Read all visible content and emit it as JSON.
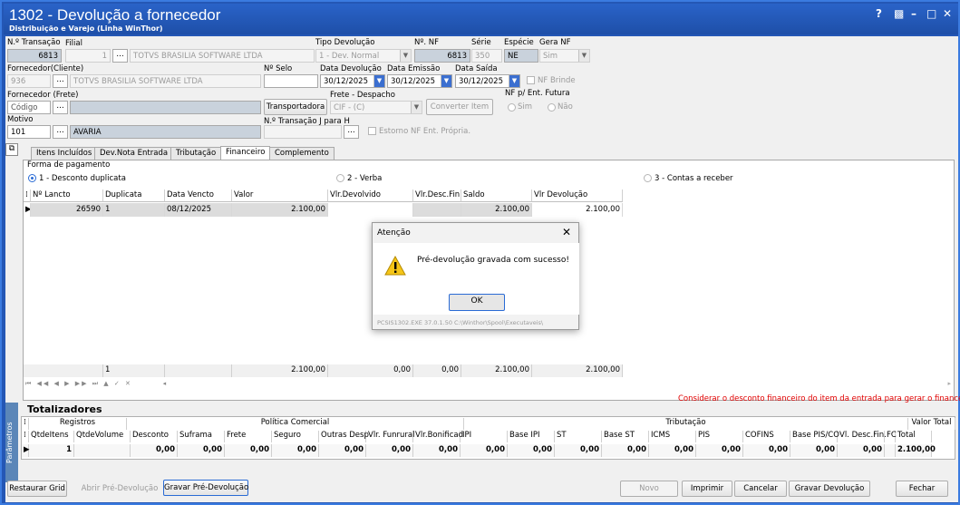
{
  "window": {
    "title": "1302 - Devolução a fornecedor",
    "subtitle": "Distribuição e Varejo (Linha WinThor)",
    "controls": {
      "help": "?",
      "restore": "▩",
      "minimize": "–",
      "maximize": "□",
      "close": "✕"
    }
  },
  "header": {
    "transacao_label": "N.º Transação",
    "transacao_value": "6813",
    "filial_label": "Filial",
    "filial_code": "1",
    "filial_name": "TOTVS BRASILIA SOFTWARE LTDA",
    "tipo_devolucao_label": "Tipo Devolução",
    "tipo_devolucao_value": "1 - Dev. Normal",
    "nf_label": "Nº. NF",
    "nf_value": "6813",
    "serie_label": "Série",
    "serie_value": "350",
    "especie_label": "Espécie",
    "especie_value": "NE",
    "gera_nf_label": "Gera NF",
    "gera_nf_value": "Sim",
    "fornecedor_cliente_label": "Fornecedor(Cliente)",
    "fornecedor_code": "936",
    "fornecedor_name": "TOTVS BRASILIA SOFTWARE LTDA",
    "selo_label": "Nº Selo",
    "selo_value": "",
    "data_devolucao_label": "Data Devolução",
    "data_devolucao_value": "30/12/2025",
    "data_emissao_label": "Data Emissão",
    "data_emissao_value": "30/12/2025",
    "data_saida_label": "Data Saída",
    "data_saida_value": "30/12/2025",
    "nf_brinde_label": "NF Brinde",
    "fornecedor_frete_label": "Fornecedor (Frete)",
    "fornecedor_frete_code": "Código",
    "transportadora_button": "Transportadora",
    "frete_label": "Frete - Despacho",
    "frete_value": "CIF - (C)",
    "converter_item_button": "Converter Item",
    "nf_futura_label": "NF p/ Ent. Futura",
    "nf_futura_sim": "Sim",
    "nf_futura_nao": "Não",
    "motivo_label": "Motivo",
    "motivo_code": "101",
    "motivo_name": "AVARIA",
    "transacao_j_label": "N.º Transação J para H",
    "estorno_label": "Estorno NF Ent. Própria.",
    "dots": "..."
  },
  "tabs": [
    {
      "label": "Itens Incluídos"
    },
    {
      "label": "Dev.Nota Entrada"
    },
    {
      "label": "Tributação"
    },
    {
      "label": "Financeiro"
    },
    {
      "label": "Complemento"
    }
  ],
  "financeiro": {
    "forma_pagamento_label": "Forma de pagamento",
    "opt1": "1 - Desconto duplicata",
    "opt2": "2 - Verba",
    "opt3": "3 - Contas a receber",
    "columns": [
      "Nº Lancto",
      "Duplicata",
      "Data Vencto",
      "Valor",
      "Vlr.Devolvido",
      "Vlr.Desc.Fin.",
      "Saldo",
      "Vlr Devolução"
    ],
    "row": {
      "lancto": "26590",
      "duplicata": "1",
      "vencto": "08/12/2025",
      "valor": "2.100,00",
      "devolvido": "",
      "desc": "",
      "saldo": "2.100,00",
      "devolucao": "2.100,00"
    },
    "footer": {
      "duplicata": "1",
      "valor": "2.100,00",
      "devolvido": "0,00",
      "desc": "0,00",
      "saldo": "2.100,00",
      "devolucao": "2.100,00"
    }
  },
  "totalizadores": {
    "title": "Totalizadores",
    "side_label": "Parâmetros",
    "warning": "Considerar o desconto financeiro do item da entrada para gerar o financeiro.",
    "groups": {
      "registros": "Registros",
      "politica": "Política Comercial",
      "tributacao": "Tributação",
      "valor_total": "Valor Total"
    },
    "columns": [
      "QtdeItens",
      "QtdeVolume",
      "Desconto",
      "Suframa",
      "Frete",
      "Seguro",
      "Outras Desp",
      "Vlr. Funrural",
      "Vlr.Bonificad",
      "IPI",
      "Base IPI",
      "ST",
      "Base ST",
      "ICMS",
      "PIS",
      "COFINS",
      "Base PIS/CO",
      "Vl. Desc.Fin.",
      "FC",
      "Total"
    ],
    "values": [
      "1",
      "",
      "0,00",
      "0,00",
      "0,00",
      "0,00",
      "0,00",
      "0,00",
      "0,00",
      "0,00",
      "0,00",
      "0,00",
      "0,00",
      "0,00",
      "0,00",
      "0,00",
      "0,00",
      "0,00",
      "",
      "2.100,00"
    ]
  },
  "buttons": {
    "restaurar": "Restaurar Grid",
    "abrir": "Abrir Pré-Devolução",
    "gravar_pre": "Gravar Pré-Devolução",
    "novo": "Novo",
    "imprimir": "Imprimir",
    "cancelar": "Cancelar",
    "gravar_dev": "Gravar Devolução",
    "fechar": "Fechar"
  },
  "dialog": {
    "title": "Atenção",
    "message": "Pré-devolução gravada com sucesso!",
    "ok": "OK",
    "footer": "PCSIS1302.EXE 37.0.1.50 C:\\Winthor\\Spool\\Executaveis\\"
  },
  "colors": {
    "titlebar": "#2457b5",
    "warning": "#e00000",
    "accent": "#2a6bd5"
  }
}
